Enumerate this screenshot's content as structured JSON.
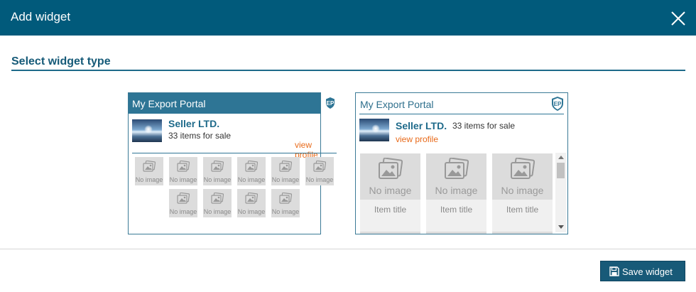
{
  "header": {
    "title": "Add widget",
    "close_icon": "close-icon"
  },
  "section": {
    "title": "Select widget type"
  },
  "widgets": [
    {
      "brand": "My Export Portal",
      "seller_name": "Seller LTD.",
      "items_for_sale": "33 items for sale",
      "view_profile": "view profile",
      "tile_label": "No image"
    },
    {
      "brand": "My Export Portal",
      "seller_name": "Seller LTD.",
      "items_for_sale": "33 items for sale",
      "view_profile": "view profile",
      "tiles": [
        {
          "image_label": "No image",
          "title": "Item title"
        },
        {
          "image_label": "No image",
          "title": "Item title"
        },
        {
          "image_label": "No image",
          "title": "Item title"
        }
      ]
    }
  ],
  "footer": {
    "save_label": "Save widget"
  },
  "colors": {
    "header": "#015a7b",
    "accent": "#1e6a8a",
    "link": "#e86a1a"
  }
}
